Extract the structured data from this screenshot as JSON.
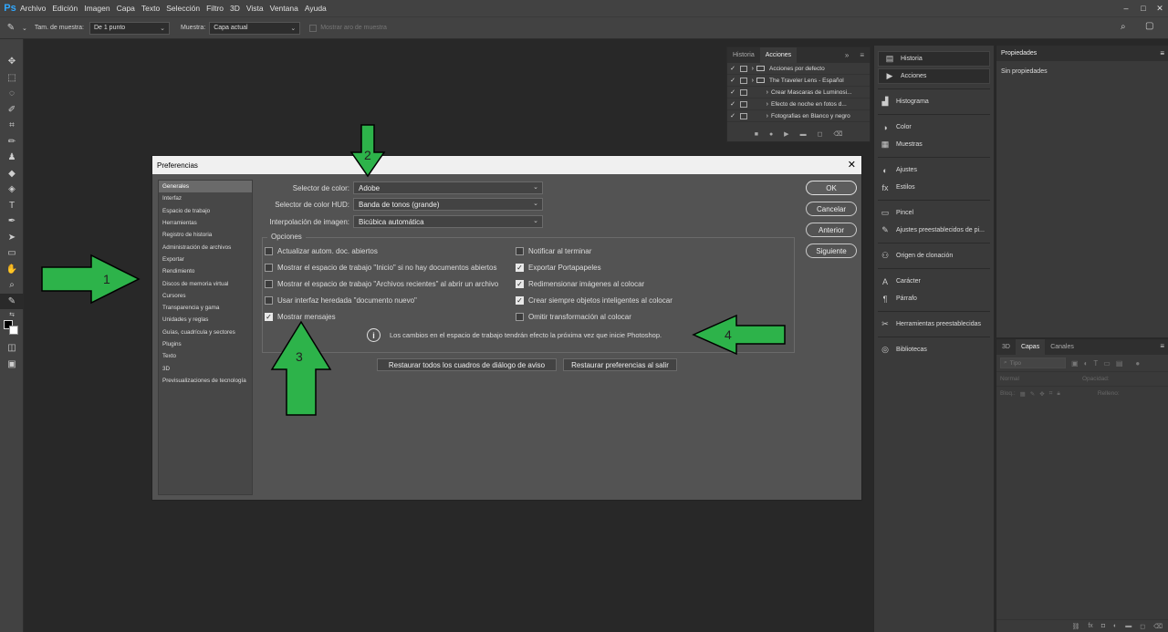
{
  "app": {
    "logo": "Ps",
    "menu": [
      "Archivo",
      "Edición",
      "Imagen",
      "Capa",
      "Texto",
      "Selección",
      "Filtro",
      "3D",
      "Vista",
      "Ventana",
      "Ayuda"
    ],
    "window_controls": [
      "–",
      "□",
      "✕"
    ]
  },
  "options_bar": {
    "sample_size_label": "Tam. de muestra:",
    "sample_size_value": "De 1 punto",
    "sample_label": "Muestra:",
    "sample_value": "Capa actual",
    "show_ring_label": "Mostrar aro de muestra"
  },
  "actions_panel": {
    "tabs": [
      "Historia",
      "Acciones"
    ],
    "rows": [
      {
        "label": "Acciones por defecto",
        "indent": 0
      },
      {
        "label": "The Traveler Lens - Español",
        "indent": 0
      },
      {
        "label": "Crear Mascaras de Luminosi...",
        "indent": 1
      },
      {
        "label": "Efecto de noche en fotos d...",
        "indent": 1
      },
      {
        "label": "Fotografias en Blanco y negro",
        "indent": 1
      }
    ]
  },
  "dock": {
    "items": [
      {
        "label": "Historia",
        "icon": "history-icon",
        "glyph": "▤",
        "hl": true,
        "gap": false
      },
      {
        "label": "Acciones",
        "icon": "play-icon",
        "glyph": "▶",
        "hl": true,
        "gap": false
      },
      {
        "label": "Histograma",
        "icon": "histogram-icon",
        "glyph": "▟",
        "hl": false,
        "gap": true
      },
      {
        "label": "Color",
        "icon": "color-icon",
        "glyph": "◑",
        "hl": false,
        "gap": true
      },
      {
        "label": "Muestras",
        "icon": "swatches-icon",
        "glyph": "▦",
        "hl": false,
        "gap": false
      },
      {
        "label": "Ajustes",
        "icon": "adjustments-icon",
        "glyph": "◐",
        "hl": false,
        "gap": true
      },
      {
        "label": "Estilos",
        "icon": "styles-icon",
        "glyph": "fx",
        "hl": false,
        "gap": false
      },
      {
        "label": "Pincel",
        "icon": "brush-icon",
        "glyph": "▭",
        "hl": false,
        "gap": true
      },
      {
        "label": "Ajustes preestablecidos de pi...",
        "icon": "brush-presets-icon",
        "glyph": "✎",
        "hl": false,
        "gap": false
      },
      {
        "label": "Origen de clonación",
        "icon": "clone-source-icon",
        "glyph": "⚇",
        "hl": false,
        "gap": true
      },
      {
        "label": "Carácter",
        "icon": "character-icon",
        "glyph": "A",
        "hl": false,
        "gap": true
      },
      {
        "label": "Párrafo",
        "icon": "paragraph-icon",
        "glyph": "¶",
        "hl": false,
        "gap": false
      },
      {
        "label": "Herramientas preestablecidas",
        "icon": "tool-presets-icon",
        "glyph": "✂",
        "hl": false,
        "gap": true
      },
      {
        "label": "Bibliotecas",
        "icon": "libraries-icon",
        "glyph": "◎",
        "hl": false,
        "gap": true
      }
    ]
  },
  "properties": {
    "title": "Propiedades",
    "empty": "Sin propiedades"
  },
  "layers": {
    "tabs": [
      "3D",
      "Capas",
      "Canales"
    ],
    "filter_placeholder": "Tipo",
    "blend": "Normal",
    "opacity_label": "Opacidad:",
    "lock_label": "Bloq.:",
    "fill_label": "Relleno:"
  },
  "dialog": {
    "title": "Preferencias",
    "categories": [
      "Generales",
      "Interfaz",
      "Espacio de trabajo",
      "Herramientas",
      "Registro de historia",
      "Administración de archivos",
      "Exportar",
      "Rendimiento",
      "Discos de memoria virtual",
      "Cursores",
      "Transparencia y gama",
      "Unidades y reglas",
      "Guías, cuadrícula y sectores",
      "Plugins",
      "Texto",
      "3D",
      "Previsualizaciones de tecnología"
    ],
    "fields": [
      {
        "label": "Selector de color:",
        "value": "Adobe"
      },
      {
        "label": "Selector de color HUD:",
        "value": "Banda de tonos (grande)"
      },
      {
        "label": "Interpolación de imagen:",
        "value": "Bicúbica automática"
      }
    ],
    "options_legend": "Opciones",
    "left_options": [
      {
        "label": "Actualizar autom. doc. abiertos",
        "checked": false
      },
      {
        "label": "Mostrar el espacio de trabajo \"Inicio\" si no hay documentos abiertos",
        "checked": false
      },
      {
        "label": "Mostrar el espacio de trabajo \"Archivos recientes\" al abrir un archivo",
        "checked": false
      },
      {
        "label": "Usar interfaz heredada \"documento nuevo\"",
        "checked": false
      },
      {
        "label": "Mostrar mensajes",
        "checked": true
      }
    ],
    "right_options": [
      {
        "label": "Notificar al terminar",
        "checked": false
      },
      {
        "label": "Exportar Portapapeles",
        "checked": true
      },
      {
        "label": "Redimensionar imágenes al colocar",
        "checked": true
      },
      {
        "label": "Crear siempre objetos inteligentes al colocar",
        "checked": true
      },
      {
        "label": "Omitir transformación al colocar",
        "checked": false
      }
    ],
    "info_text": "Los cambios en el espacio de trabajo tendrán efecto la próxima vez que inicie Photoshop.",
    "reset_dialogs": "Restaurar todos los cuadros de diálogo de aviso",
    "reset_prefs": "Restaurar preferencias al salir",
    "buttons": {
      "ok": "OK",
      "cancel": "Cancelar",
      "prev": "Anterior",
      "next": "Siguiente"
    }
  },
  "annotations": [
    "1",
    "2",
    "3",
    "4"
  ],
  "colors": {
    "arrow": "#2db34a",
    "accent": "#31a8ff"
  }
}
